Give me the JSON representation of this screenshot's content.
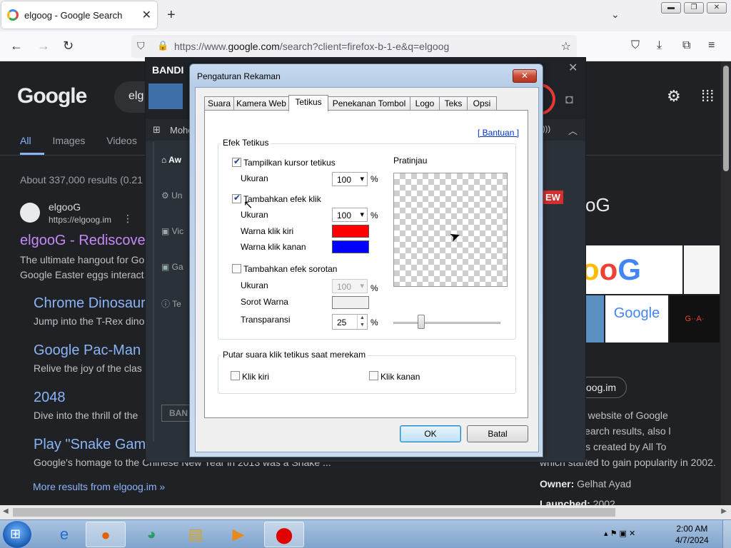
{
  "browser": {
    "tab_title": "elgoog - Google Search",
    "tab_close": "✕",
    "new_tab": "+",
    "tab_list": "⌄",
    "url_prefix": "https://www.",
    "url_domain": "google.com",
    "url_rest": "/search?client=firefox-b-1-e&q=elgoog",
    "icons": {
      "back": "←",
      "forward": "→",
      "reload": "↻",
      "shield": "⛉",
      "lock": "🔒",
      "star": "☆",
      "pocket": "⛉",
      "download": "⤓",
      "extensions": "⧉",
      "menu": "≡"
    }
  },
  "window_controls": {
    "minimize": "▬",
    "maximize": "❐",
    "close": "✕"
  },
  "google": {
    "logo": "Google",
    "query": "elg",
    "tabs": [
      "All",
      "Images",
      "Videos"
    ],
    "result_count": "About 337,000 results (0.21",
    "site_name": "elgooG",
    "site_url": "https://elgoog.im",
    "result_title": "elgooG - Rediscove",
    "result_snippet": [
      "The ultimate hangout for Go",
      "Google Easter eggs interact"
    ],
    "sublinks": [
      {
        "title": "Chrome Dinosaur",
        "snippet": "Jump into the T-Rex dino"
      },
      {
        "title": "Google Pac-Man",
        "snippet": "Relive the joy of the clas"
      },
      {
        "title": "2048",
        "snippet": "Dive into the thrill of the"
      },
      {
        "title": "Play \"Snake Gam",
        "snippet": "Google's homage to the Chinese New Year in 2013 was a Snake ..."
      }
    ],
    "more_results": "More results from elgoog.im »",
    "kp_title": "oG",
    "kp_logo_text": "oogle",
    "kp_doodle": "Google",
    "kp_game": "G··A·",
    "kp_chip": "oog.im",
    "kp_lines": [
      "a mirrored website of Google",
      "y flipped search results, also l",
      "rror\". It was created by All To",
      "which started to gain popularity in 2002."
    ],
    "owner_label": "Owner:",
    "owner_value": "Gelhat Ayad",
    "launched_label": "Launched:",
    "launched_value": "2002"
  },
  "bandicam": {
    "logo": "BANDI",
    "close": "✕",
    "menu_text": "Mohe",
    "menu_right": ")))",
    "menu_up": "︿",
    "side_items": [
      "Aw",
      "Un",
      "Vic",
      "Ga",
      "Te"
    ],
    "new_badge": "EW",
    "footer_logo": "BAN"
  },
  "dialog": {
    "title": "Pengaturan Rekaman",
    "close": "✕",
    "tabs": [
      "Suara",
      "Kamera Web",
      "Tetikus",
      "Penekanan Tombol",
      "Logo",
      "Teks",
      "Opsi"
    ],
    "active_tab": "Tetikus",
    "help_link": "[ Bantuan ]",
    "group_effect": "Efek Tetikus",
    "show_cursor": "Tampilkan kursor tetikus",
    "show_cursor_checked": true,
    "size_label": "Ukuran",
    "cursor_size": "100",
    "percent": "%",
    "click_effect": "Tambahkan efek klik",
    "click_effect_checked": true,
    "click_size": "100",
    "left_click_color_label": "Warna klik kiri",
    "left_click_color": "#ff0000",
    "right_click_color_label": "Warna klik kanan",
    "right_click_color": "#0000ff",
    "highlight_effect": "Tambahkan efek sorotan",
    "highlight_checked": false,
    "highlight_size": "100",
    "highlight_color_label": "Sorot Warna",
    "highlight_color": "#f0f0f0",
    "transparency_label": "Transparansi",
    "transparency_value": "25",
    "preview_label": "Pratinjau",
    "group_sound": "Putar suara klik tetikus saat merekam",
    "sound_left": "Klik kiri",
    "sound_right": "Klik kanan",
    "ok": "OK",
    "cancel": "Batal"
  },
  "taskbar": {
    "items": [
      "ie-icon",
      "firefox-icon",
      "bandicam-icon",
      "explorer-icon",
      "media-icon",
      "record-icon"
    ],
    "time": "2:00 AM",
    "date": "4/7/2024"
  }
}
